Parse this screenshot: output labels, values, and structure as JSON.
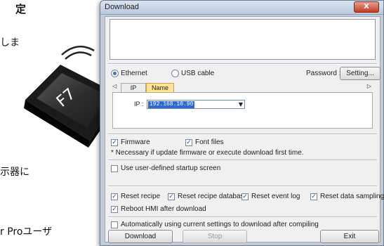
{
  "background": {
    "lines": [
      "定",
      "しま",
      "示器に",
      "r Proユーザ"
    ],
    "key_label": "F7"
  },
  "dialog": {
    "title": "Download",
    "close_glyph": "X",
    "connection": {
      "ethernet_label": "Ethernet",
      "usb_label": "USB cable",
      "selected": "Ethernet",
      "password_label": "Password :",
      "setting_button": "Setting..."
    },
    "tabs": [
      {
        "label": "IP",
        "active": false
      },
      {
        "label": "Name",
        "active": true
      }
    ],
    "tab_scroll_glyph": "▷",
    "tab_scroll_left_glyph": "◁",
    "ip": {
      "label": "IP :",
      "value": "192.168.10.90"
    },
    "options": {
      "firmware": {
        "label": "Firmware",
        "checked": true
      },
      "font_files": {
        "label": "Font files",
        "checked": true
      },
      "note": "* Necessary if update firmware or execute download first time.",
      "startup_screen": {
        "label": "Use user-defined startup screen",
        "checked": false
      },
      "reset_recipe": {
        "label": "Reset recipe",
        "checked": true
      },
      "reset_recipe_database": {
        "label": "Reset recipe database",
        "checked": true
      },
      "reset_event_log": {
        "label": "Reset event log",
        "checked": true
      },
      "reset_data_sampling": {
        "label": "Reset data sampling",
        "checked": true
      },
      "reboot_hmi": {
        "label": "Reboot HMI after download",
        "checked": true
      },
      "auto_download": {
        "label": "Automatically using current settings to download after compiling",
        "checked": false
      }
    },
    "buttons": {
      "download": "Download",
      "stop": "Stop",
      "exit": "Exit"
    }
  }
}
